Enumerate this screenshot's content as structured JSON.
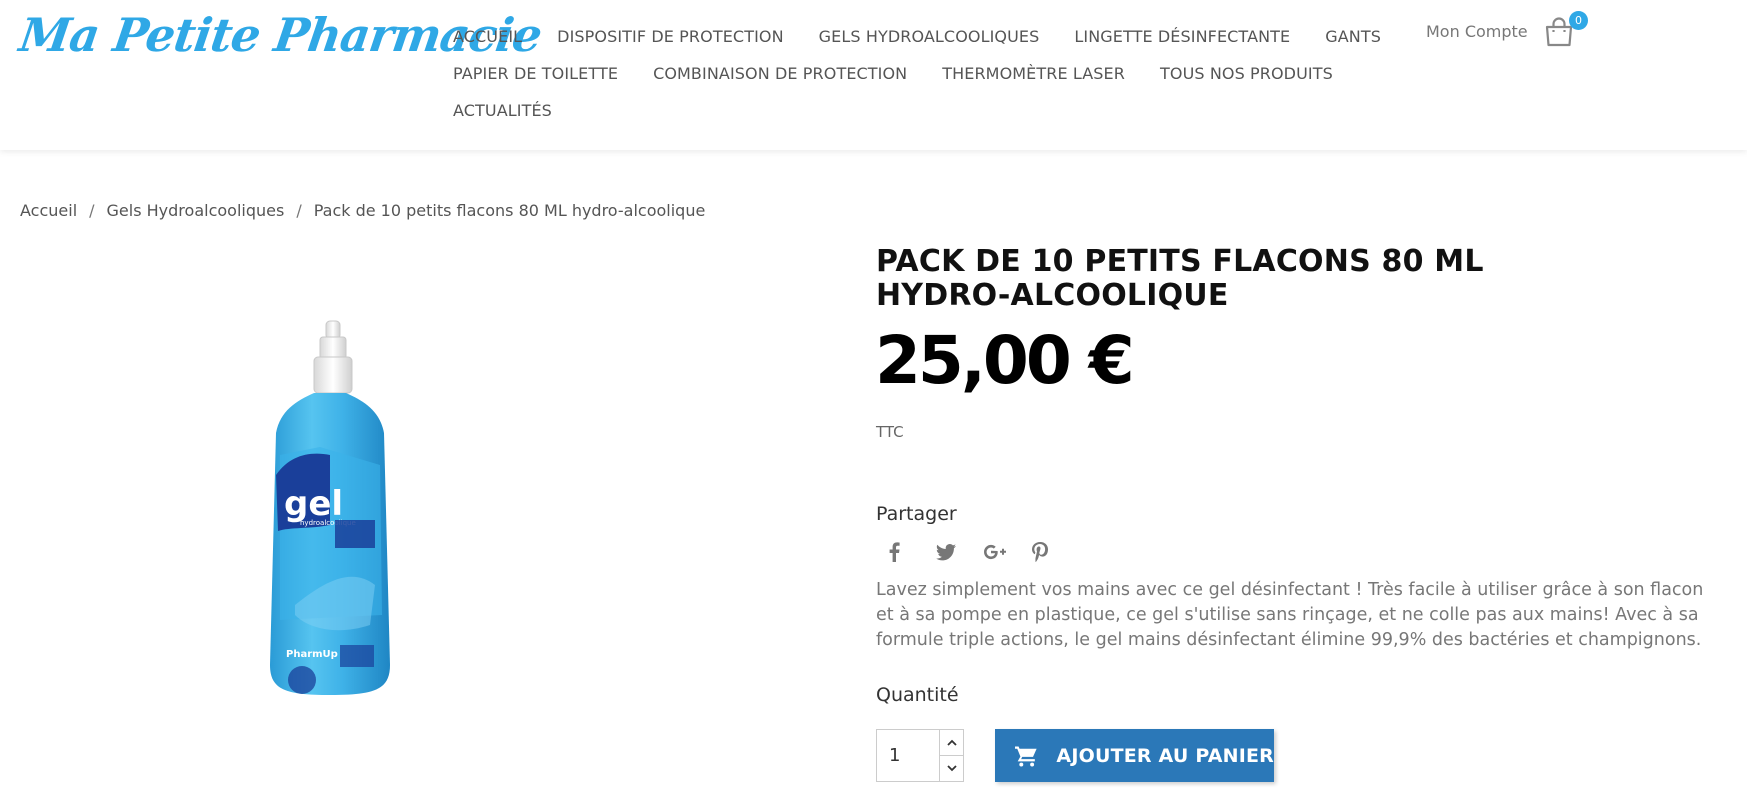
{
  "header": {
    "logo_text": "Ma Petite Pharmacie",
    "nav": [
      [
        "ACCUEIL",
        "DISPOSITIF DE PROTECTION",
        "GELS HYDROALCOOLIQUES",
        "LINGETTE DÉSINFECTANTE",
        "GANTS"
      ],
      [
        "PAPIER DE TOILETTE",
        "COMBINAISON DE PROTECTION",
        "THERMOMÈTRE LASER",
        "TOUS NOS PRODUITS"
      ],
      [
        "ACTUALITÉS"
      ]
    ],
    "account_label": "Mon Compte",
    "cart_count": "0",
    "cart_icon": "shopping-bag-icon"
  },
  "breadcrumb": [
    "Accueil",
    "Gels Hydroalcooliques",
    "Pack de 10 petits flacons 80 ML hydro-alcoolique"
  ],
  "product": {
    "title": "PACK DE 10 PETITS FLACONS 80 ML HYDRO-ALCOOLIQUE",
    "price": "25,00 €",
    "tax_label": "TTC",
    "share_label": "Partager",
    "social_icons": [
      "facebook-icon",
      "twitter-icon",
      "google-plus-icon",
      "pinterest-icon"
    ],
    "description": "Lavez simplement vos mains avec ce gel désinfectant ! Très facile à utiliser grâce à son flacon et à sa pompe en plastique, ce gel s'utilise sans rinçage, et ne colle pas aux mains! Avec à sa formule triple actions, le gel mains désinfectant élimine 99,9% des bactéries et champignons.",
    "quantity_label": "Quantité",
    "quantity_value": "1",
    "add_to_cart_label": "AJOUTER AU PANIER",
    "image_label": "gel",
    "image_sublabel": "hydroalcoolique",
    "image_brand": "PharmUp"
  },
  "colors": {
    "brand": "#2fa8e6",
    "button": "#2b78b8"
  }
}
